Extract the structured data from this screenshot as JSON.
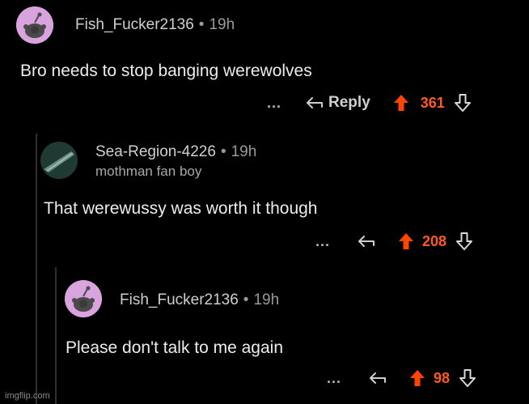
{
  "comments": [
    {
      "username": "Fish_Fucker2136",
      "time": "19h",
      "body": "Bro needs to stop banging werewolves",
      "more": "...",
      "reply_label": "Reply",
      "score": "361"
    },
    {
      "username": "Sea-Region-4226",
      "time": "19h",
      "flair": "mothman fan boy",
      "body": "That werewussy was worth it though",
      "more": "...",
      "score": "208"
    },
    {
      "username": "Fish_Fucker2136",
      "time": "19h",
      "body": "Please don't talk to me again",
      "more": "...",
      "score": "98"
    }
  ],
  "separator": "•",
  "watermark": "imgflip.com",
  "colors": {
    "upvote": "#ff4500",
    "score": "#ff5a1f",
    "background": "#000000"
  },
  "icons": [
    "snoo-avatar-icon",
    "reply-arrow-icon",
    "upvote-arrow-icon",
    "downvote-arrow-icon"
  ]
}
